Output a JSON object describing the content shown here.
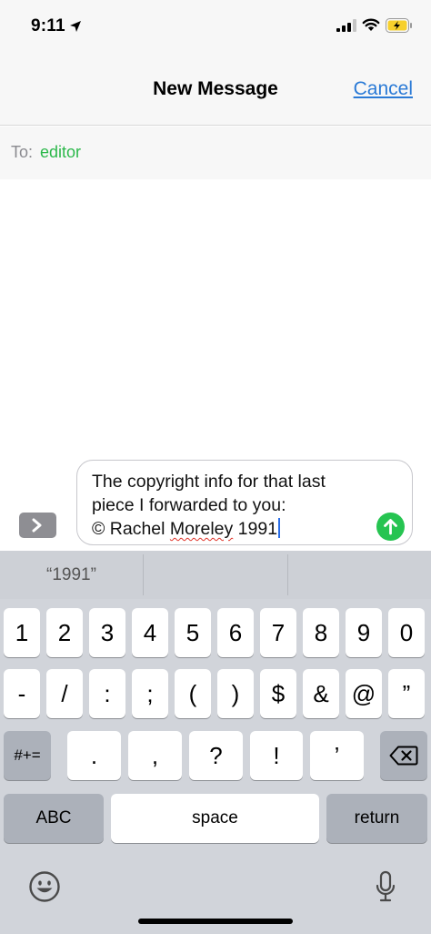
{
  "status": {
    "time": "9:11"
  },
  "nav": {
    "title": "New Message",
    "cancel": "Cancel"
  },
  "to": {
    "label": "To:",
    "recipient": "editor"
  },
  "compose": {
    "line1": "The copyright info for that last",
    "line2": "piece I forwarded to you:",
    "line3_prefix": "© Rachel ",
    "line3_flagged": "Moreley",
    "line3_suffix": " 1991"
  },
  "keyboard": {
    "suggestions": [
      "“1991”",
      "",
      ""
    ],
    "row1": [
      "1",
      "2",
      "3",
      "4",
      "5",
      "6",
      "7",
      "8",
      "9",
      "0"
    ],
    "row2": [
      "-",
      "/",
      ":",
      ";",
      "(",
      ")",
      "$",
      "&",
      "@",
      "”"
    ],
    "row3": {
      "symbols": "#+=",
      "keys": [
        ".",
        ",",
        "?",
        "!",
        "’"
      ]
    },
    "row4": {
      "abc": "ABC",
      "space": "space",
      "return": "return"
    }
  },
  "icons": {
    "location": "location-arrow-icon",
    "signal": "cellular-signal-icon",
    "wifi": "wifi-icon",
    "battery": "battery-charging-icon",
    "apps": "chevron-right-icon",
    "send": "arrow-up-icon",
    "delete": "backspace-icon",
    "emoji": "emoji-icon",
    "mic": "microphone-icon"
  },
  "colors": {
    "accent": "#2a7ad6",
    "recipient": "#2bb84a",
    "send": "#26c451",
    "battery": "#f7d02c"
  }
}
